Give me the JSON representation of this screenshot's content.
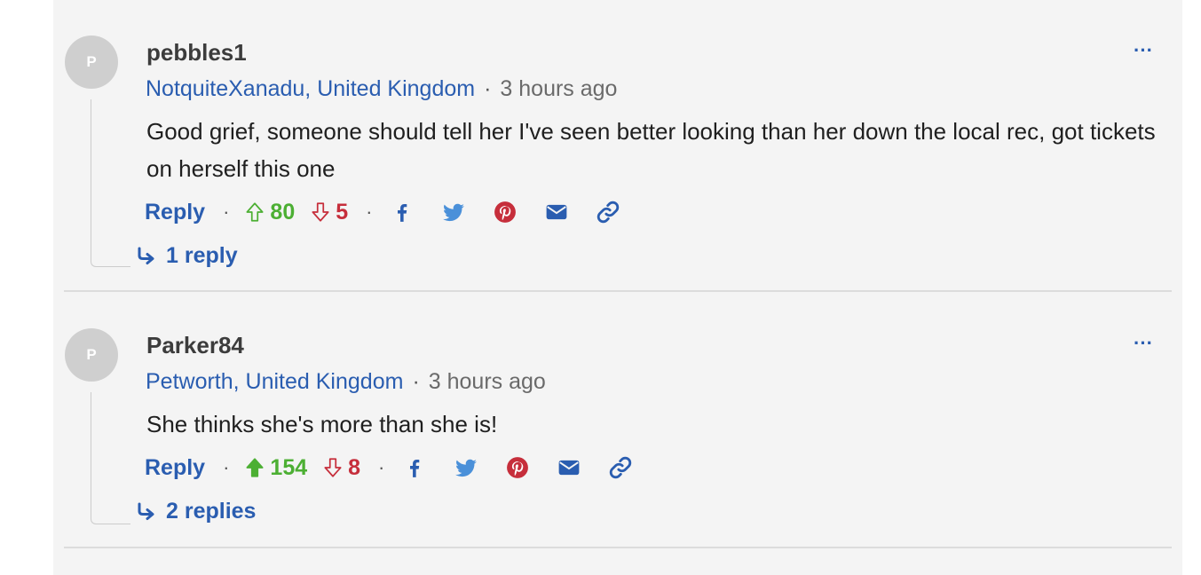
{
  "comments": [
    {
      "avatar_initial": "P",
      "username": "pebbles1",
      "location": "NotquiteXanadu, United Kingdom",
      "separator": "·",
      "time": "3 hours ago",
      "text": "Good grief, someone should tell her I've seen better looking than her down the local rec, got tickets on herself this one",
      "reply_label": "Reply",
      "upvotes": "80",
      "downvotes": "5",
      "upvoted": false,
      "replies_label": "1 reply",
      "more_label": "···"
    },
    {
      "avatar_initial": "P",
      "username": "Parker84",
      "location": "Petworth, United Kingdom",
      "separator": "·",
      "time": "3 hours ago",
      "text": "She thinks she's more than she is!",
      "reply_label": "Reply",
      "upvotes": "154",
      "downvotes": "8",
      "upvoted": true,
      "replies_label": "2 replies",
      "more_label": "···"
    }
  ],
  "colors": {
    "link_blue": "#2a5db0",
    "upvote_green": "#4caf33",
    "downvote_red": "#c62e3b",
    "facebook": "#2a5db0",
    "twitter": "#4a90d9",
    "pinterest": "#c62e3b",
    "email": "#2a5db0",
    "link_icon": "#2a5db0"
  },
  "share_icons": [
    "facebook-icon",
    "twitter-icon",
    "pinterest-icon",
    "email-icon",
    "link-icon"
  ]
}
